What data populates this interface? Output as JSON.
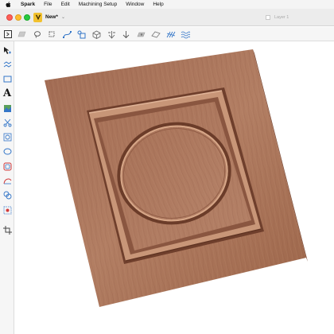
{
  "menubar": {
    "items": [
      "Spark",
      "File",
      "Edit",
      "Machining Setup",
      "Window",
      "Help"
    ]
  },
  "window": {
    "doc_title": "New*",
    "chevron": "⌄",
    "layer_label": "Layer 1"
  },
  "toolbar": {
    "tools": [
      "panel-toggle-icon",
      "flat-stock-icon",
      "lasso-icon",
      "crop-icon",
      "node-edit-icon",
      "transform-icon",
      "box-3d-icon",
      "align-icon",
      "arrow-down-icon",
      "image-icon",
      "tilt-plane-icon",
      "hatch-icon",
      "texture-icon"
    ]
  },
  "rail": {
    "tools": [
      "select-arrow-icon",
      "wave-icon",
      "rectangle-icon",
      "text-icon",
      "image-trace-icon",
      "scissors-icon",
      "circle-node-icon",
      "ellipse-icon",
      "rounded-rect-icon",
      "curve-icon",
      "shapes-icon",
      "target-icon",
      "crop-tool-icon"
    ],
    "text_tool_label": "A"
  },
  "colors": {
    "wood_light": "#b07a60",
    "wood_dark": "#8f5a42",
    "accent_blue": "#3476c8"
  }
}
